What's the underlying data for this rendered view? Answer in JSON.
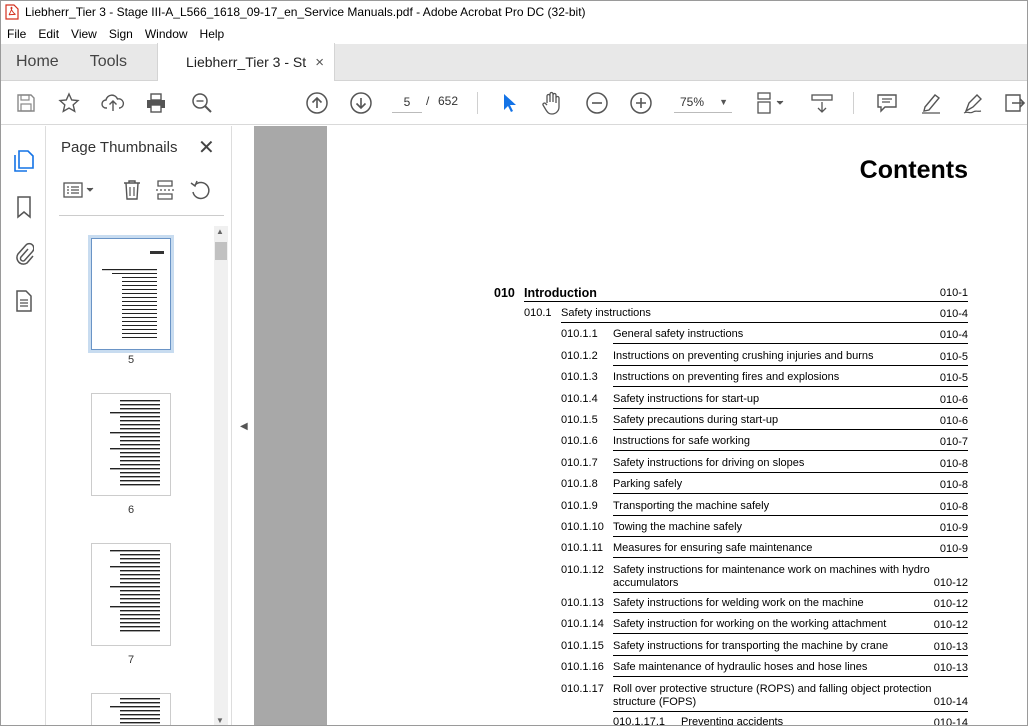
{
  "window": {
    "title": "Liebherr_Tier 3 - Stage III-A_L566_1618_09-17_en_Service Manuals.pdf - Adobe Acrobat Pro DC (32-bit)"
  },
  "menu": [
    "File",
    "Edit",
    "View",
    "Sign",
    "Window",
    "Help"
  ],
  "tabs": {
    "home": "Home",
    "tools": "Tools",
    "doc": "Liebherr_Tier 3 - St...",
    "close": "×"
  },
  "toolbar": {
    "page_current": "5",
    "page_sep": "/",
    "page_total": "652",
    "zoom": "75%",
    "zoom_arrow": "▼"
  },
  "panel": {
    "title": "Page Thumbnails",
    "close": "✕",
    "thumb_labels": [
      "5",
      "6",
      "7"
    ]
  },
  "page": {
    "heading": "Contents",
    "toc": [
      {
        "level": 0,
        "num": "010",
        "text": "Introduction",
        "page": "010-1"
      },
      {
        "level": 1,
        "num": "010.1",
        "text": "Safety instructions",
        "page": "010-4"
      },
      {
        "level": 2,
        "num": "010.1.1",
        "text": "General safety instructions",
        "page": "010-4"
      },
      {
        "level": 2,
        "num": "010.1.2",
        "text": "Instructions on preventing crushing injuries and burns",
        "page": "010-5"
      },
      {
        "level": 2,
        "num": "010.1.3",
        "text": "Instructions on preventing fires and explosions",
        "page": "010-5"
      },
      {
        "level": 2,
        "num": "010.1.4",
        "text": "Safety instructions for start-up",
        "page": "010-6"
      },
      {
        "level": 2,
        "num": "010.1.5",
        "text": "Safety precautions during start-up",
        "page": "010-6"
      },
      {
        "level": 2,
        "num": "010.1.6",
        "text": "Instructions for safe working",
        "page": "010-7"
      },
      {
        "level": 2,
        "num": "010.1.7",
        "text": "Safety instructions for driving on slopes",
        "page": "010-8"
      },
      {
        "level": 2,
        "num": "010.1.8",
        "text": "Parking safely",
        "page": "010-8"
      },
      {
        "level": 2,
        "num": "010.1.9",
        "text": "Transporting the machine safely",
        "page": "010-8"
      },
      {
        "level": 2,
        "num": "010.1.10",
        "text": "Towing the machine safely",
        "page": "010-9"
      },
      {
        "level": 2,
        "num": "010.1.11",
        "text": "Measures for ensuring safe maintenance",
        "page": "010-9"
      },
      {
        "level": 2,
        "num": "010.1.12",
        "text": "Safety instructions for maintenance work on machines with hydro",
        "text2": "accumulators",
        "page": "010-12"
      },
      {
        "level": 2,
        "num": "010.1.13",
        "text": "Safety instructions for welding work on the machine",
        "page": "010-12"
      },
      {
        "level": 2,
        "num": "010.1.14",
        "text": "Safety instruction for working on the working attachment",
        "page": "010-12"
      },
      {
        "level": 2,
        "num": "010.1.15",
        "text": "Safety instructions for transporting the machine by crane",
        "page": "010-13"
      },
      {
        "level": 2,
        "num": "010.1.16",
        "text": "Safe maintenance of hydraulic hoses and hose lines",
        "page": "010-13"
      },
      {
        "level": 2,
        "num": "010.1.17",
        "text": "Roll over protective structure (ROPS) and falling object protection",
        "text2": "structure (FOPS)",
        "page": "010-14"
      },
      {
        "level": 3,
        "num": "010.1.17.1",
        "text": "Preventing accidents",
        "page": "010-14"
      }
    ]
  }
}
